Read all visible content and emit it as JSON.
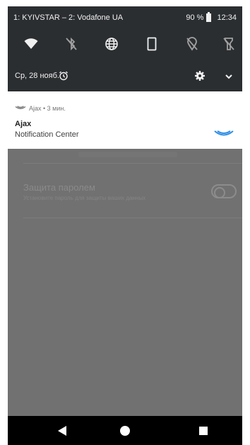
{
  "status_bar": {
    "carrier": "1: KYIVSTAR – 2: Vodafone UA",
    "battery": "90 %",
    "time": "12:34"
  },
  "quick_settings": [
    {
      "icon": "wifi-icon",
      "state": "on"
    },
    {
      "icon": "bluetooth-off-icon",
      "state": "off"
    },
    {
      "icon": "globe-icon",
      "state": "on"
    },
    {
      "icon": "phone-rotation-icon",
      "state": "on"
    },
    {
      "icon": "location-off-icon",
      "state": "off"
    },
    {
      "icon": "flashlight-off-icon",
      "state": "off"
    }
  ],
  "shade": {
    "date": "Ср, 28 нояб."
  },
  "notification": {
    "app": "Ajax",
    "time_ago": "3 мин.",
    "title": "Ajax",
    "text": "Notification Center"
  },
  "background_app": {
    "title": "Защита паролем",
    "subtitle": "Установите пароль для защиты ваших данных"
  },
  "colors": {
    "shade_bg": "#2b2e31",
    "accent_blue": "#2f8ee5",
    "dim_overlay": "#717171"
  }
}
